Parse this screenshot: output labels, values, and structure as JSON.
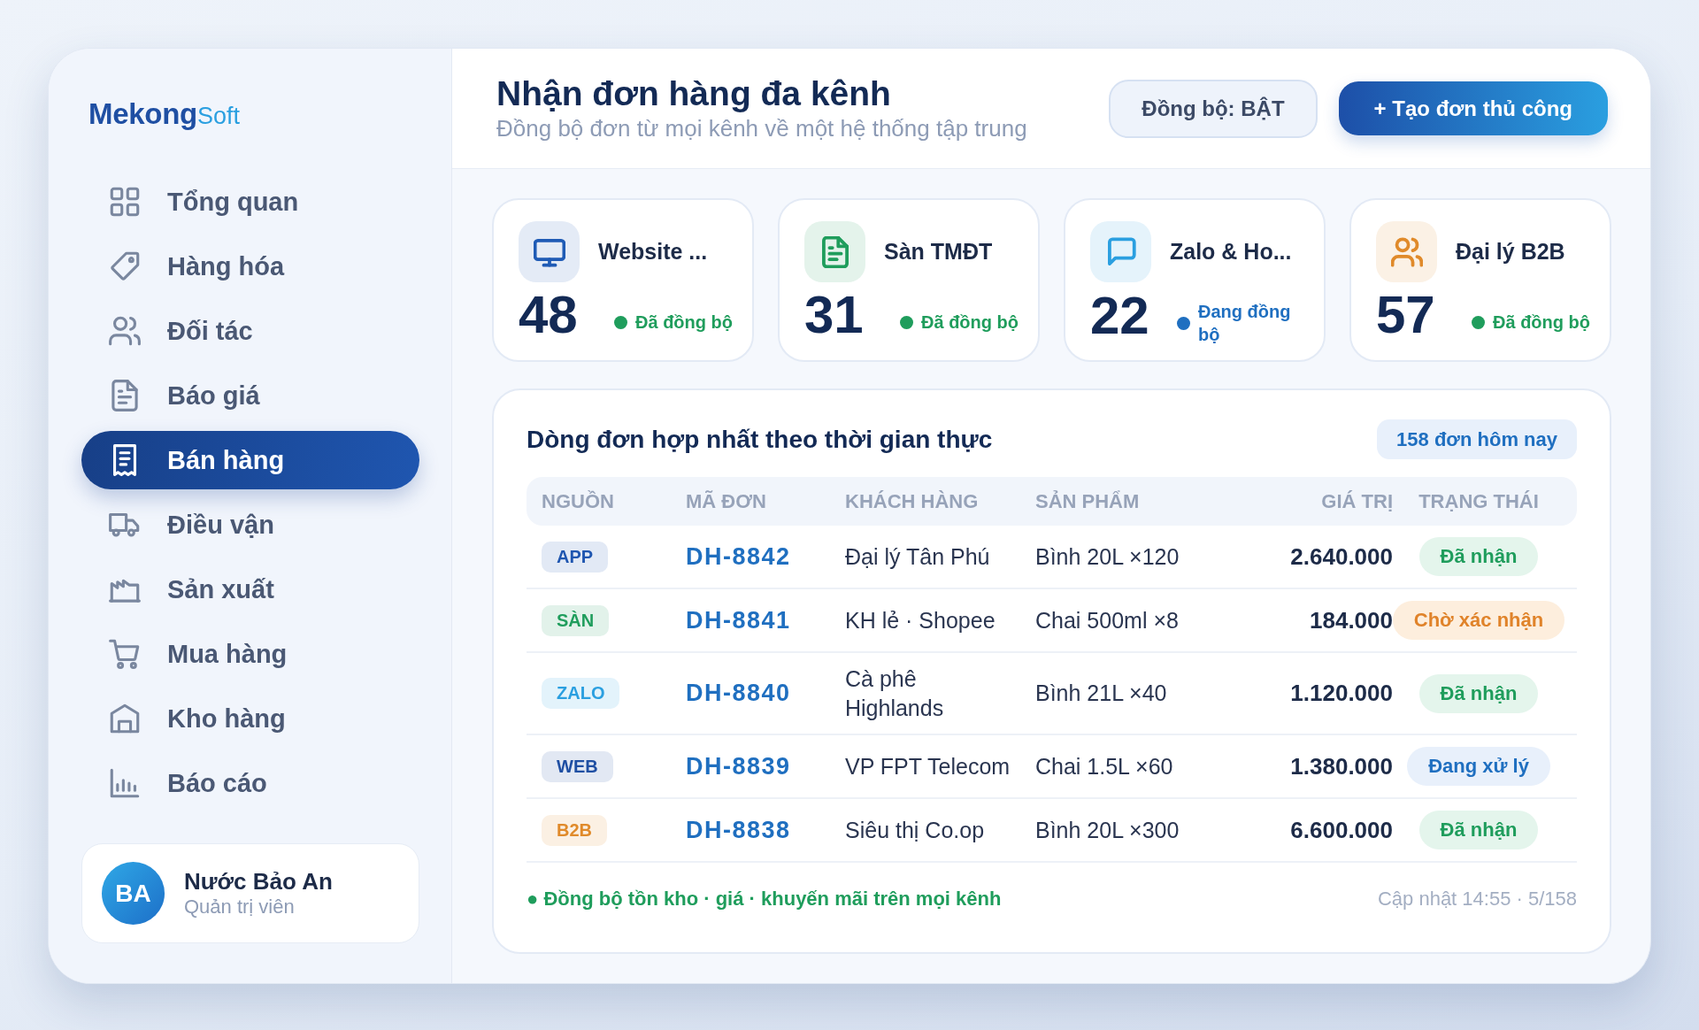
{
  "sidebar": {
    "logo": {
      "primary": "Mekong",
      "secondary": "Soft"
    },
    "items": [
      {
        "label": "Tổng quan",
        "selected": false
      },
      {
        "label": "Hàng hóa",
        "selected": false
      },
      {
        "label": "Đối tác",
        "selected": false
      },
      {
        "label": "Báo giá",
        "selected": false
      },
      {
        "label": "Bán hàng",
        "selected": true
      },
      {
        "label": "Điều vận",
        "selected": false
      },
      {
        "label": "Sản xuất",
        "selected": false
      },
      {
        "label": "Mua hàng",
        "selected": false
      },
      {
        "label": "Kho hàng",
        "selected": false
      },
      {
        "label": "Báo cáo",
        "selected": false
      }
    ],
    "user": {
      "initials": "BA",
      "name": "Nước Bảo An",
      "role": "Quản trị viên"
    }
  },
  "header": {
    "title": "Nhận đơn hàng đa kênh",
    "subtitle": "Đồng bộ đơn từ mọi kênh về một hệ thống tập trung",
    "sync_button": "Đồng bộ: BẬT",
    "create_button": "+ Tạo đơn thủ công"
  },
  "channels": [
    {
      "name": "Website ...",
      "count": "48",
      "status": "Đã đồng bộ",
      "synced": true,
      "color": "#1f5bb5"
    },
    {
      "name": "Sàn TMĐT",
      "count": "31",
      "status": "Đã đồng bộ",
      "synced": true,
      "color": "#1f9d5c"
    },
    {
      "name": "Zalo & Ho...",
      "count": "22",
      "status": "Đang đồng bộ",
      "synced": false,
      "color": "#2a9fe0"
    },
    {
      "name": "Đại lý B2B",
      "count": "57",
      "status": "Đã đồng bộ",
      "synced": true,
      "color": "#e08a2a"
    }
  ],
  "orders": {
    "title": "Dòng đơn hợp nhất theo thời gian thực",
    "badge": "158 đơn hôm nay",
    "columns": [
      "NGUỒN",
      "MÃ ĐƠN",
      "KHÁCH HÀNG",
      "SẢN PHẨM",
      "GIÁ TRỊ",
      "TRẠNG THÁI"
    ],
    "rows": [
      {
        "source": {
          "label": "APP",
          "color": "#1f56b0"
        },
        "order_id": "DH-8842",
        "customer": "Đại lý Tân Phú",
        "product": "Bình 20L ×120",
        "value": "2.640.000",
        "status": {
          "label": "Đã nhận",
          "kind": "done"
        }
      },
      {
        "source": {
          "label": "SÀN",
          "color": "#1f9d5c"
        },
        "order_id": "DH-8841",
        "customer": "KH lẻ · Shopee",
        "product": "Chai 500ml ×8",
        "value": "184.000",
        "status": {
          "label": "Chờ xác nhận",
          "kind": "pending"
        }
      },
      {
        "source": {
          "label": "ZALO",
          "color": "#2a9fe0"
        },
        "order_id": "DH-8840",
        "customer": "Cà phê Highlands",
        "product": "Bình 21L ×40",
        "value": "1.120.000",
        "status": {
          "label": "Đã nhận",
          "kind": "done"
        }
      },
      {
        "source": {
          "label": "WEB",
          "color": "#1f4fa3"
        },
        "order_id": "DH-8839",
        "customer": "VP FPT Telecom",
        "product": "Chai 1.5L ×60",
        "value": "1.380.000",
        "status": {
          "label": "Đang xử lý",
          "kind": "progress"
        }
      },
      {
        "source": {
          "label": "B2B",
          "color": "#e08a2a"
        },
        "order_id": "DH-8838",
        "customer": "Siêu thị Co.op",
        "product": "Bình 20L ×300",
        "value": "6.600.000",
        "status": {
          "label": "Đã nhận",
          "kind": "done"
        }
      }
    ],
    "footer_note": "● Đồng bộ tồn kho · giá · khuyến mãi trên mọi kênh",
    "updated": "Cập nhật 14:55 · 5/158"
  }
}
